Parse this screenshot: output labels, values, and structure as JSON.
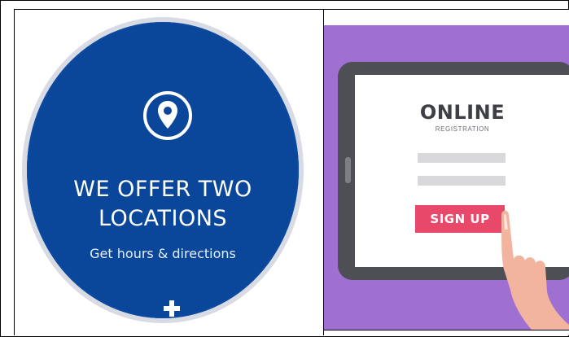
{
  "left_card": {
    "headline_line1": "WE OFFER TWO",
    "headline_line2": "LOCATIONS",
    "subtext": "Get hours & directions"
  },
  "right_card": {
    "title": "ONLINE",
    "subtitle": "REGISTRATION",
    "button_label": "SIGN UP"
  },
  "colors": {
    "circle_blue": "#0a479a",
    "background_purple": "#a06fd2",
    "signup_pink": "#e8496a"
  },
  "icons": {
    "location": "location-pin-icon",
    "expand": "plus-icon"
  }
}
